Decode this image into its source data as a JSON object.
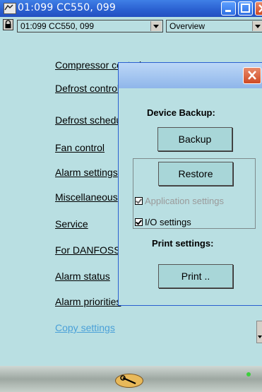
{
  "window": {
    "title": "01:099 CC550, 099",
    "controls": {
      "minimize": "minimize",
      "maximize": "maximize",
      "close": "close"
    }
  },
  "toolbar": {
    "controller_select": "01:099 CC550, 099",
    "view_select": "Overview"
  },
  "menu": {
    "items": [
      "Compressor control",
      "Defrost control",
      "Defrost schedule",
      "Fan control",
      "Alarm settings",
      "Miscellaneous",
      "Service",
      "For DANFOSS",
      "Alarm status",
      "Alarm priorities",
      "Copy settings"
    ]
  },
  "dialog": {
    "device_backup_label": "Device Backup:",
    "backup_button": "Backup",
    "restore_button": "Restore",
    "application_settings_label": "Application settings",
    "application_settings_checked": true,
    "application_settings_enabled": false,
    "io_settings_label": "I/O settings",
    "io_settings_checked": true,
    "print_settings_label": "Print settings:",
    "print_button": "Print .."
  },
  "colors": {
    "background": "#b9dfe2",
    "titlebar": "#2a5fd0",
    "link_visited": "#4aa0d8",
    "status_led": "#3bd03b"
  }
}
